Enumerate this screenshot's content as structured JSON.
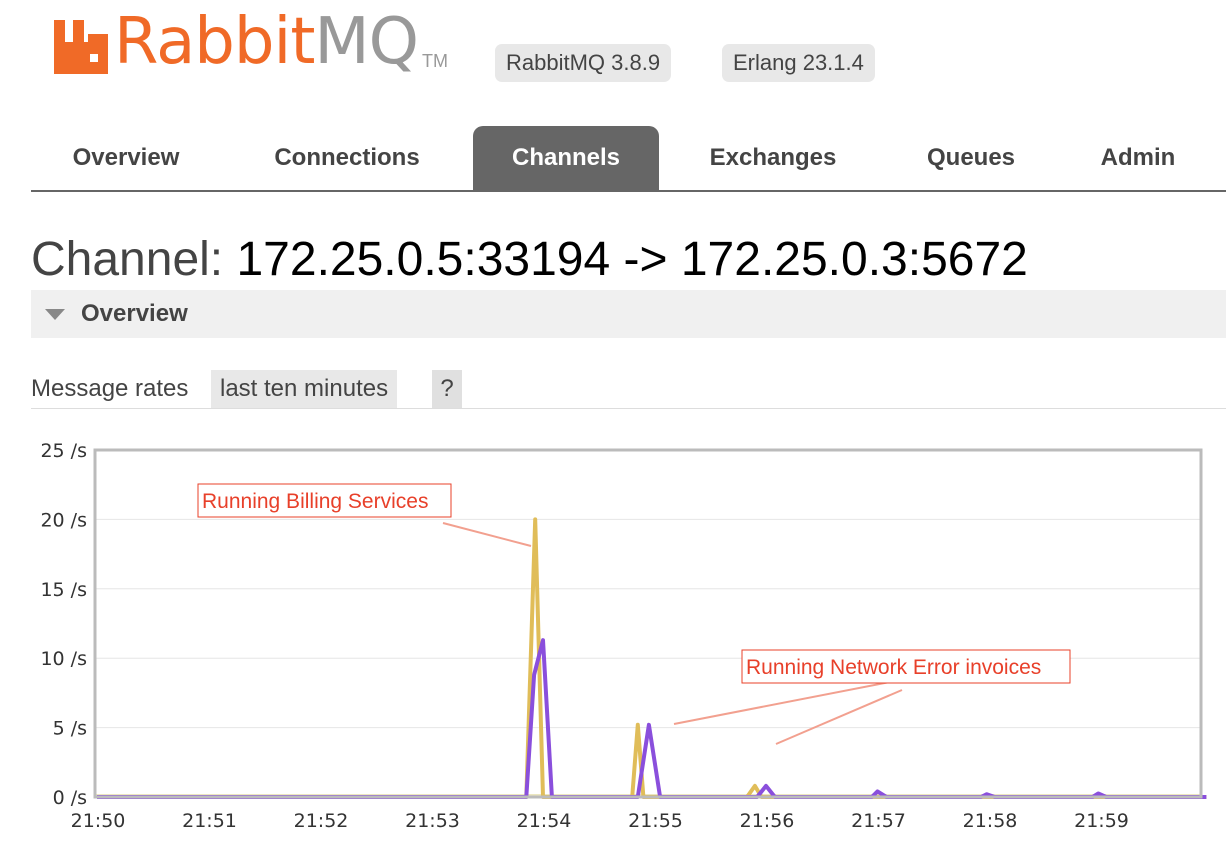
{
  "brand": {
    "word_a": "Rabbit",
    "word_b": "MQ",
    "tm": "TM",
    "color_primary": "#f06a27",
    "color_secondary": "#999999",
    "logo_icon": "rabbitmq-logo-icon"
  },
  "versions": {
    "rabbitmq": "RabbitMQ 3.8.9",
    "erlang": "Erlang 23.1.4"
  },
  "nav": {
    "tabs": [
      {
        "label": "Overview",
        "active": false
      },
      {
        "label": "Connections",
        "active": false
      },
      {
        "label": "Channels",
        "active": true
      },
      {
        "label": "Exchanges",
        "active": false
      },
      {
        "label": "Queues",
        "active": false
      },
      {
        "label": "Admin",
        "active": false
      }
    ]
  },
  "page": {
    "title_label": "Channel:",
    "title_value": "172.25.0.5:33194 -> 172.25.0.3:5672"
  },
  "section": {
    "label": "Overview",
    "state_icon": "triangle-down-icon"
  },
  "rates": {
    "label": "Message rates",
    "range": "last ten minutes",
    "help": "?"
  },
  "chart_data": {
    "type": "line",
    "title": "",
    "xlabel": "",
    "ylabel": "",
    "ylim": [
      0,
      25
    ],
    "yticks": [
      "0 /s",
      "5 /s",
      "10 /s",
      "15 /s",
      "20 /s",
      "25 /s"
    ],
    "y_tick_values": [
      0,
      5,
      10,
      15,
      20,
      25
    ],
    "xticks": [
      "21:50",
      "21:51",
      "21:52",
      "21:53",
      "21:54",
      "21:55",
      "21:56",
      "21:57",
      "21:58",
      "21:59"
    ],
    "xlim_minutes": [
      0,
      9.95
    ],
    "grid": true,
    "series": [
      {
        "color": "#e0bd59",
        "points": [
          [
            0,
            0
          ],
          [
            3.85,
            0
          ],
          [
            3.93,
            20
          ],
          [
            4.0,
            0
          ],
          [
            4.8,
            0
          ],
          [
            4.85,
            5.2
          ],
          [
            4.9,
            0
          ],
          [
            5.83,
            0
          ],
          [
            5.9,
            0.8
          ],
          [
            5.96,
            0
          ],
          [
            9.95,
            0
          ]
        ]
      },
      {
        "color": "#8a4fdc",
        "points": [
          [
            0,
            0
          ],
          [
            3.85,
            0
          ],
          [
            3.92,
            8.8
          ],
          [
            4.0,
            11.3
          ],
          [
            4.08,
            0
          ],
          [
            4.85,
            0
          ],
          [
            4.95,
            5.2
          ],
          [
            5.05,
            0
          ],
          [
            5.92,
            0
          ],
          [
            6.0,
            0.8
          ],
          [
            6.08,
            0
          ],
          [
            6.95,
            0
          ],
          [
            7.0,
            0.4
          ],
          [
            7.08,
            0
          ],
          [
            7.93,
            0
          ],
          [
            7.98,
            0.2
          ],
          [
            8.05,
            0
          ],
          [
            8.93,
            0
          ],
          [
            8.98,
            0.25
          ],
          [
            9.05,
            0
          ],
          [
            9.95,
            0
          ]
        ]
      }
    ],
    "annotations": [
      {
        "text": "Running Billing Services",
        "target": [
          3.9,
          18.9
        ]
      },
      {
        "text": "Running Network Error invoices",
        "target": [
          5.1,
          5.3
        ]
      }
    ]
  }
}
